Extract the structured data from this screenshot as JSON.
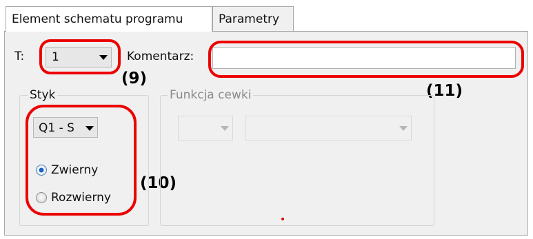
{
  "tabs": [
    {
      "label": "Element schematu programu",
      "active": true
    },
    {
      "label": "Parametry",
      "active": false
    }
  ],
  "t_field": {
    "label": "T:",
    "value": "1"
  },
  "comment_field": {
    "label": "Komentarz:",
    "value": ""
  },
  "styk_group": {
    "title": "Styk",
    "contact_select": "Q1 - S",
    "radios": [
      {
        "label": "Zwierny",
        "checked": true
      },
      {
        "label": "Rozwierny",
        "checked": false
      }
    ]
  },
  "coil_group": {
    "title": "Funkcja cewki",
    "select1": "",
    "select2": ""
  },
  "annotations": {
    "a9": "(9)",
    "a10": "(10)",
    "a11": "(11)"
  },
  "colors": {
    "highlight": "#ec0000",
    "panel_bg": "#f0f0f0"
  }
}
